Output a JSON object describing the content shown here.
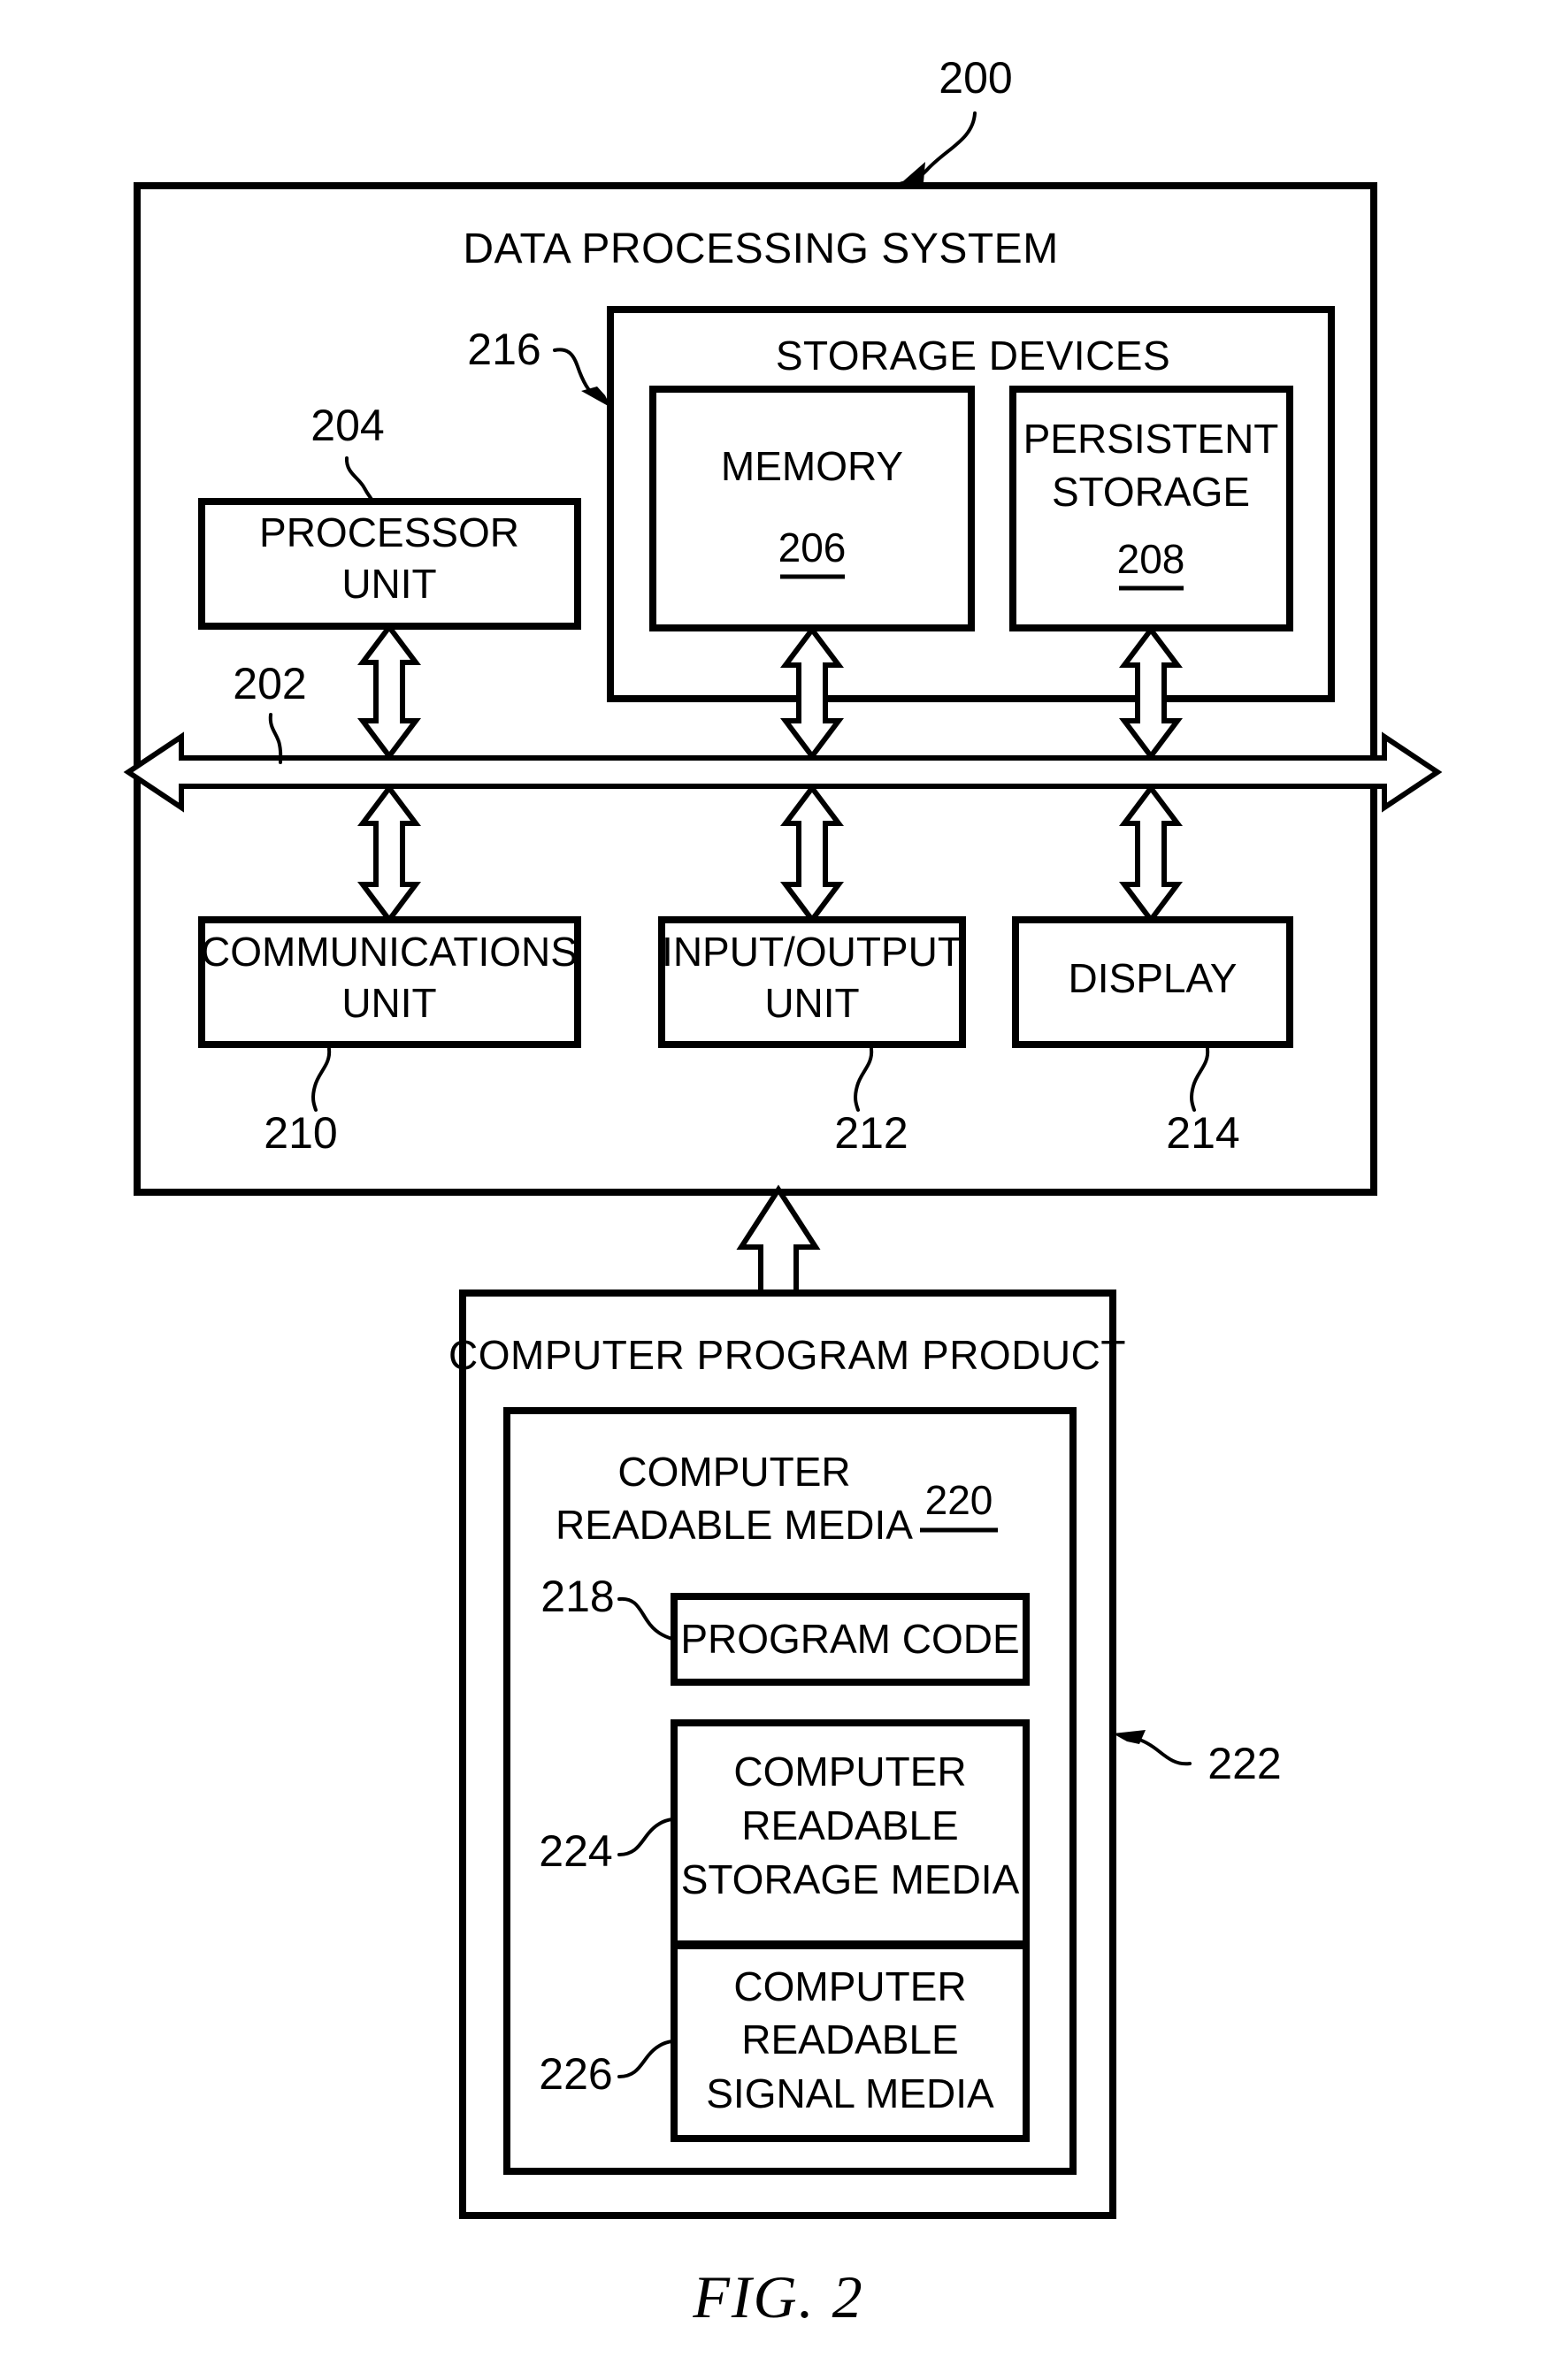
{
  "figure": {
    "caption": "FIG. 2",
    "top_reference": "200"
  },
  "system": {
    "title": "DATA PROCESSING SYSTEM",
    "reference": "200",
    "bus": {
      "name": "bus",
      "reference": "202"
    },
    "storage_group": {
      "title": "STORAGE DEVICES",
      "reference": "216",
      "items": [
        {
          "label": "MEMORY",
          "reference": "206"
        },
        {
          "label_line1": "PERSISTENT",
          "label_line2": "STORAGE",
          "reference": "208"
        }
      ]
    },
    "processor": {
      "line1": "PROCESSOR",
      "line2": "UNIT",
      "reference": "204"
    },
    "bottom_units": [
      {
        "line1": "COMMUNICATIONS",
        "line2": "UNIT",
        "reference": "210"
      },
      {
        "line1": "INPUT/OUTPUT",
        "line2": "UNIT",
        "reference": "212"
      },
      {
        "line1": "DISPLAY",
        "line2": "",
        "reference": "214"
      }
    ]
  },
  "program_product": {
    "title": "COMPUTER PROGRAM PRODUCT",
    "reference": "222",
    "media": {
      "line1": "COMPUTER",
      "line2": "READABLE MEDIA",
      "reference": "220"
    },
    "items": [
      {
        "line1": "PROGRAM CODE",
        "line2": "",
        "line3": "",
        "reference": "218"
      },
      {
        "line1": "COMPUTER",
        "line2": "READABLE",
        "line3": "STORAGE MEDIA",
        "reference": "224"
      },
      {
        "line1": "COMPUTER",
        "line2": "READABLE",
        "line3": "SIGNAL MEDIA",
        "reference": "226"
      }
    ]
  },
  "colors": {
    "ink": "#000000",
    "paper": "#ffffff"
  }
}
